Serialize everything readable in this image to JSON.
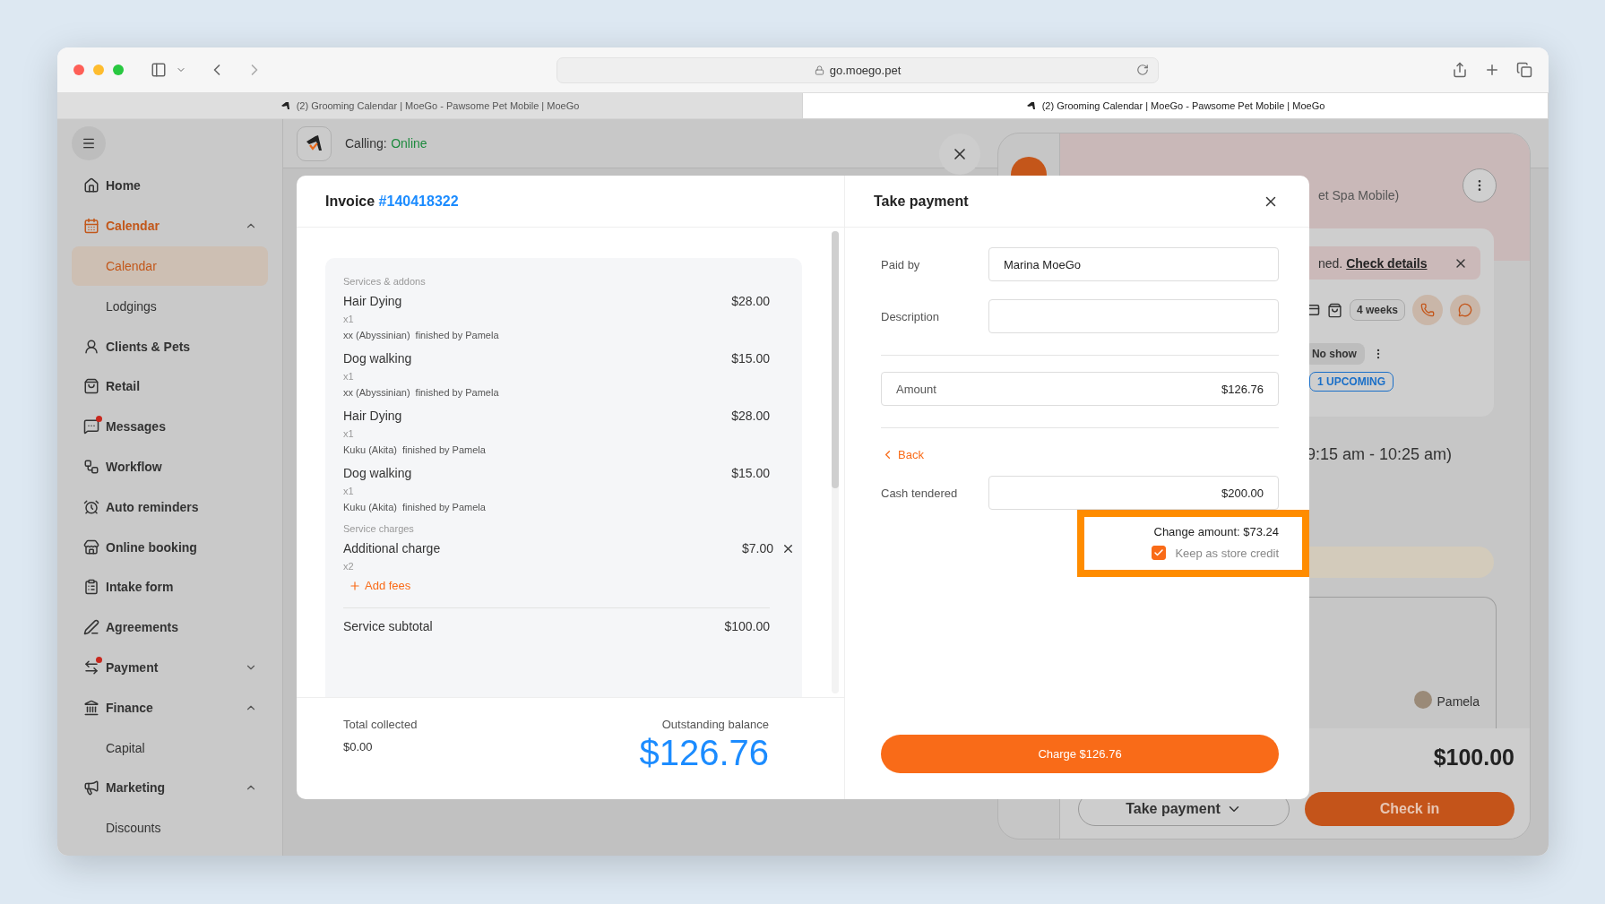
{
  "browser": {
    "url": "go.moego.pet",
    "tabs": [
      {
        "title": "(2) Grooming Calendar | MoeGo - Pawsome Pet Mobile | MoeGo",
        "selected": false
      },
      {
        "title": "(2) Grooming Calendar | MoeGo - Pawsome Pet Mobile | MoeGo",
        "selected": true
      }
    ]
  },
  "sidebar": {
    "items": [
      {
        "label": "Home",
        "selected": false,
        "notification": false
      },
      {
        "label": "Calendar",
        "selected": true,
        "notification": false,
        "expanded": true,
        "children": [
          {
            "label": "Calendar",
            "selected": true
          },
          {
            "label": "Lodgings",
            "selected": false
          }
        ]
      },
      {
        "label": "Clients & Pets",
        "selected": false,
        "notification": false
      },
      {
        "label": "Retail",
        "selected": false,
        "notification": false
      },
      {
        "label": "Messages",
        "selected": false,
        "notification": true
      },
      {
        "label": "Workflow",
        "selected": false,
        "notification": false
      },
      {
        "label": "Auto reminders",
        "selected": false,
        "notification": false
      },
      {
        "label": "Online booking",
        "selected": false,
        "notification": false
      },
      {
        "label": "Intake form",
        "selected": false,
        "notification": false
      },
      {
        "label": "Agreements",
        "selected": false,
        "notification": false
      },
      {
        "label": "Payment",
        "selected": false,
        "notification": true,
        "expanded": false
      },
      {
        "label": "Finance",
        "selected": false,
        "notification": false,
        "expanded": true,
        "children": [
          {
            "label": "Capital",
            "selected": false
          }
        ]
      },
      {
        "label": "Marketing",
        "selected": false,
        "notification": false,
        "expanded": true,
        "children": [
          {
            "label": "Discounts",
            "selected": false
          }
        ]
      }
    ]
  },
  "topbar": {
    "calling_label": "Calling:",
    "calling_status": "Online"
  },
  "invoice": {
    "title": "Invoice",
    "number": "#140418322",
    "sections": [
      {
        "heading": "Services & addons",
        "items": [
          {
            "name": "Hair Dying",
            "price": "$28.00",
            "quantity": "x1",
            "pet": "xx (Abyssinian)",
            "staff": "finished by Pamela",
            "removable": false
          },
          {
            "name": "Dog walking",
            "price": "$15.00",
            "quantity": "x1",
            "pet": "xx (Abyssinian)",
            "staff": "finished by Pamela",
            "removable": false
          },
          {
            "name": "Hair Dying",
            "price": "$28.00",
            "quantity": "x1",
            "pet": "Kuku (Akita)",
            "staff": "finished by Pamela",
            "removable": false
          },
          {
            "name": "Dog walking",
            "price": "$15.00",
            "quantity": "x1",
            "pet": "Kuku (Akita)",
            "staff": "finished by Pamela",
            "removable": false
          }
        ]
      },
      {
        "heading": "Service charges",
        "items": [
          {
            "name": "Additional charge",
            "price": "$7.00",
            "quantity": "x2",
            "removable": true
          }
        ]
      }
    ],
    "add_fees": "Add fees",
    "subtotal_label": "Service subtotal",
    "subtotal": "$100.00",
    "total_collected_label": "Total collected",
    "total_collected": "$0.00",
    "outstanding_label": "Outstanding balance",
    "outstanding": "$126.76"
  },
  "payment": {
    "title": "Take payment",
    "paid_by_label": "Paid by",
    "paid_by": "Marina MoeGo",
    "description_label": "Description",
    "amount_label": "Amount",
    "amount": "$126.76",
    "back": "Back",
    "cash_label": "Cash tendered",
    "cash": "$200.00",
    "change": "Change amount: $73.24",
    "store_credit": {
      "label": "Keep as store credit",
      "checked": true
    },
    "charge": "Charge $126.76"
  },
  "appointment": {
    "location_fragment": "et Spa Mobile)",
    "alert_fragment": "ned.",
    "alert_link": "Check details",
    "frequency": "4 weeks",
    "no_show": "No show",
    "upcoming": "1 UPCOMING",
    "time_fragment": "9:15 am - 10:25 am)",
    "staff": "Pamela",
    "total": "$100.00",
    "take_payment": "Take payment",
    "check_in": "Check in"
  }
}
